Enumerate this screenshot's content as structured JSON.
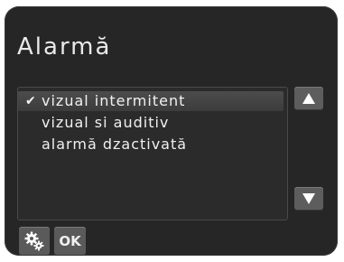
{
  "dialog": {
    "title": "Alarmă"
  },
  "options": [
    {
      "label": "vizual intermitent",
      "selected": true
    },
    {
      "label": "vizual si auditiv",
      "selected": false
    },
    {
      "label": "alarmă dzactivată",
      "selected": false
    }
  ],
  "icons": {
    "check": "✔",
    "settings": "gears-icon",
    "scroll_up": "arrow-up-icon",
    "scroll_down": "arrow-down-icon"
  },
  "buttons": {
    "ok_label": "OK"
  },
  "colors": {
    "screen_bg": "#262626",
    "button_bg": "#5a5a5a",
    "selection_bg": "#444444",
    "text": "#f0f0f0"
  }
}
